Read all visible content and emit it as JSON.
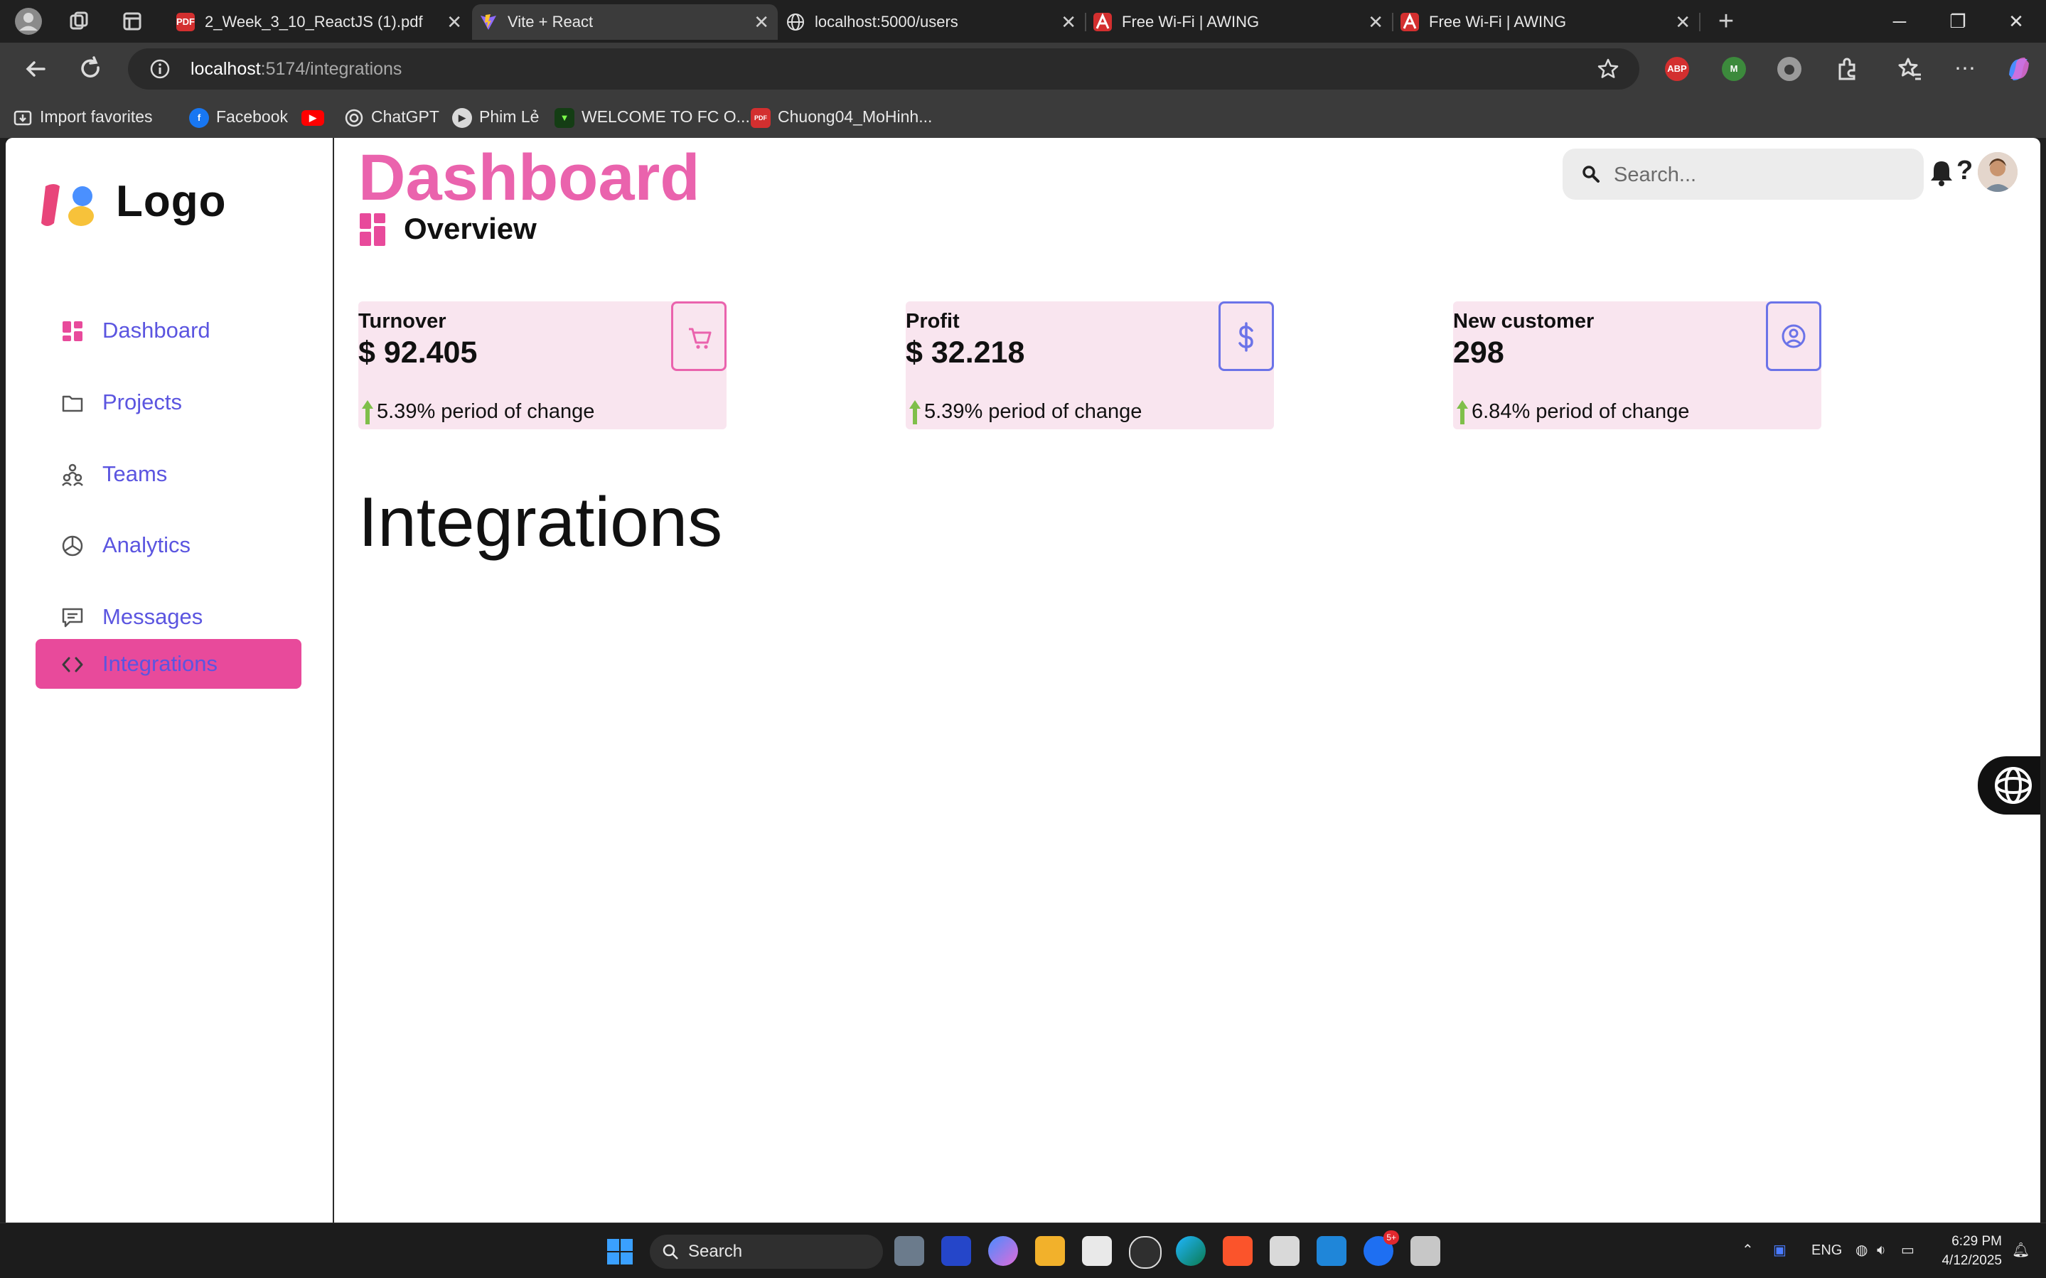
{
  "browser": {
    "tabs": [
      {
        "title": "2_Week_3_10_ReactJS (1).pdf",
        "favicon": "pdf-icon",
        "active": false
      },
      {
        "title": "Vite + React",
        "favicon": "vite-icon",
        "active": true
      },
      {
        "title": "localhost:5000/users",
        "favicon": "globe-icon",
        "active": false
      },
      {
        "title": "Free Wi-Fi | AWING",
        "favicon": "awing-icon",
        "active": false
      },
      {
        "title": "Free Wi-Fi | AWING",
        "favicon": "awing-icon",
        "active": false
      }
    ],
    "pdf_badge": "PDF",
    "url": {
      "host": "localhost",
      "path": ":5174/integrations"
    },
    "extensions": {
      "adblock": "ABP"
    },
    "bookmarks": [
      {
        "label": "Import favorites",
        "icon": "import-icon"
      },
      {
        "label": "Facebook",
        "icon": "facebook-icon"
      },
      {
        "label": "",
        "icon": "youtube-icon"
      },
      {
        "label": "ChatGPT",
        "icon": "chatgpt-icon"
      },
      {
        "label": "Phim Lẻ",
        "icon": "film-icon"
      },
      {
        "label": "WELCOME TO FC O...",
        "icon": "fc-icon"
      },
      {
        "label": "Chuong04_MoHinh...",
        "icon": "pdf-icon"
      }
    ]
  },
  "app": {
    "logo_text": "Logo",
    "sidebar": {
      "items": [
        {
          "label": "Dashboard",
          "icon": "grid-icon",
          "active": false
        },
        {
          "label": "Projects",
          "icon": "folder-icon",
          "active": false
        },
        {
          "label": "Teams",
          "icon": "people-icon",
          "active": false
        },
        {
          "label": "Analytics",
          "icon": "pie-chart-icon",
          "active": false
        },
        {
          "label": "Messages",
          "icon": "message-icon",
          "active": false
        },
        {
          "label": "Integrations",
          "icon": "code-icon",
          "active": true
        }
      ]
    },
    "header": {
      "title": "Dashboard",
      "subtitle": "Overview",
      "search_placeholder": "Search..."
    },
    "cards": [
      {
        "title": "Turnover",
        "value": "$ 92.405",
        "trend": "5.39% period of change",
        "icon": "cart-icon",
        "accent": "#ea63ad"
      },
      {
        "title": "Profit",
        "value": "$ 32.218",
        "trend": "5.39% period of change",
        "icon": "dollar-icon",
        "accent": "#6b73e8"
      },
      {
        "title": "New customer",
        "value": "298",
        "trend": "6.84% period of change",
        "icon": "user-circle-icon",
        "accent": "#6b73e8"
      }
    ],
    "section_heading": "Integrations",
    "colors": {
      "brand_pink": "#ea63ad",
      "active_bg": "#e84a9b",
      "link_blue": "#5b55e0",
      "card_bg": "#f9e5ef"
    }
  },
  "taskbar": {
    "search_label": "Search",
    "chat_badge": "5+",
    "language": "ENG",
    "time": "6:29 PM",
    "date": "4/12/2025"
  }
}
